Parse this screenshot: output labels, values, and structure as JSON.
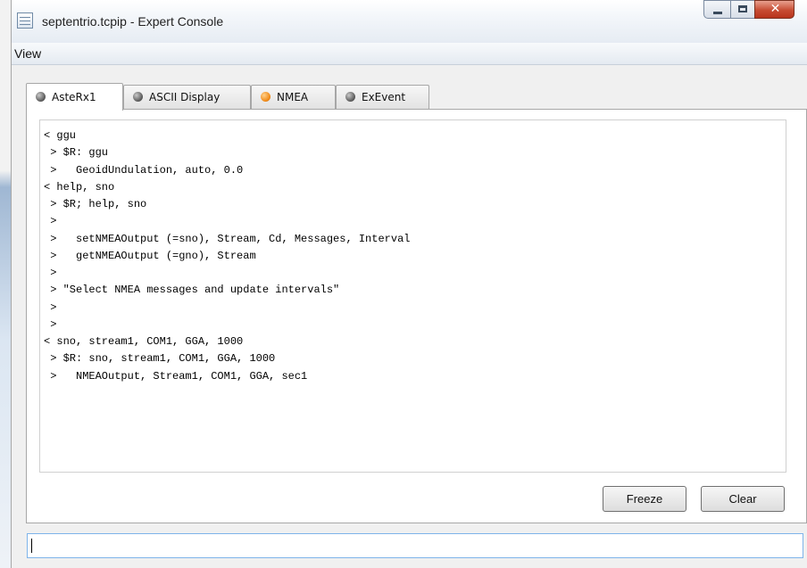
{
  "window": {
    "title": "septentrio.tcpip - Expert Console"
  },
  "menu": {
    "items": [
      "View"
    ]
  },
  "tabs": [
    {
      "label": "AsteRx1",
      "status": "gray"
    },
    {
      "label": "ASCII Display",
      "status": "gray"
    },
    {
      "label": "NMEA",
      "status": "orange"
    },
    {
      "label": "ExEvent",
      "status": "gray"
    }
  ],
  "console": {
    "lines": [
      "< ggu",
      " > $R: ggu",
      " >   GeoidUndulation, auto, 0.0",
      "< help, sno",
      " > $R; help, sno",
      " >",
      " >   setNMEAOutput (=sno), Stream, Cd, Messages, Interval",
      " >   getNMEAOutput (=gno), Stream",
      " >",
      " > \"Select NMEA messages and update intervals\"",
      " >",
      " >",
      "< sno, stream1, COM1, GGA, 1000",
      " > $R: sno, stream1, COM1, GGA, 1000",
      " >   NMEAOutput, Stream1, COM1, GGA, sec1"
    ]
  },
  "buttons": {
    "freeze": "Freeze",
    "clear": "Clear"
  },
  "command": {
    "value": ""
  },
  "colors": {
    "status_gray": "#555555",
    "status_orange": "#f08a18",
    "input_border": "#7eb4ea"
  }
}
